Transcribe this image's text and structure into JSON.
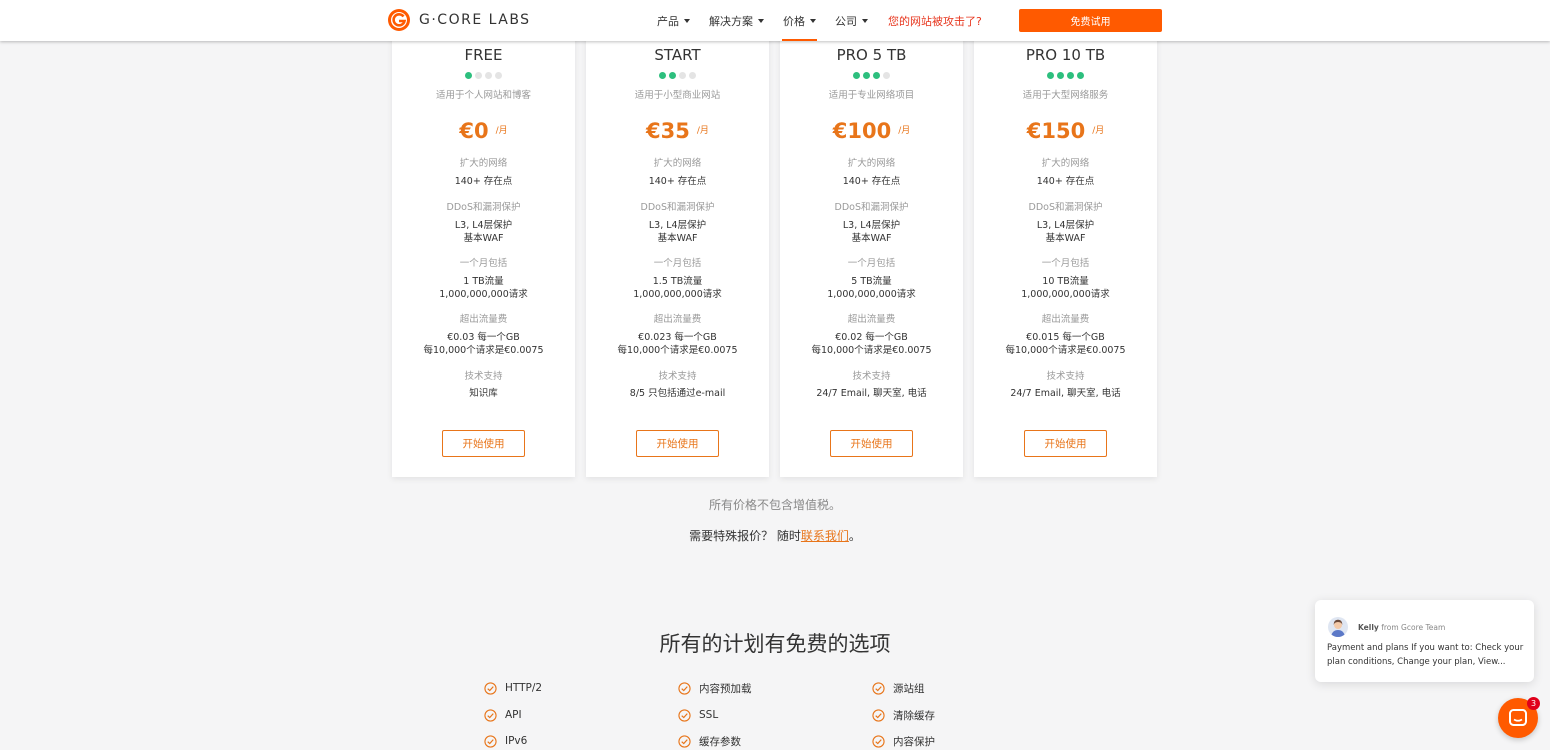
{
  "header": {
    "logo_text": "G·CORE LABS",
    "nav": [
      {
        "label": "产品",
        "dropdown": true
      },
      {
        "label": "解决方案",
        "dropdown": true
      },
      {
        "label": "价格",
        "dropdown": true,
        "active": true
      },
      {
        "label": "公司",
        "dropdown": true
      }
    ],
    "alert_link": "您的网站被攻击了?",
    "trial_button": "免费试用"
  },
  "colors": {
    "accent": "#ff5a00",
    "price": "#e8751a",
    "dot_on": "#2dbf7e",
    "alert": "#e7361e"
  },
  "plans": [
    {
      "name": "FREE",
      "level": 1,
      "desc": "适用于个人网站和博客",
      "price": "€0",
      "unit": "/月",
      "net_label": "扩大的网络",
      "net_val": "140+ 存在点",
      "ddos_label": "DDoS和漏洞保护",
      "ddos_val1": "L3, L4层保护",
      "ddos_val2": "基本WAF",
      "incl_label": "一个月包括",
      "incl_val1": "1 TB流量",
      "incl_val2": "1,000,000,000请求",
      "over_label": "超出流量费",
      "over_val1": "€0.03 每一个GB",
      "over_val2": "每10,000个请求是€0.0075",
      "sup_label": "技术支持",
      "sup_val": "知识库",
      "button": "开始使用"
    },
    {
      "name": "START",
      "level": 2,
      "desc": "适用于小型商业网站",
      "price": "€35",
      "unit": "/月",
      "net_label": "扩大的网络",
      "net_val": "140+ 存在点",
      "ddos_label": "DDoS和漏洞保护",
      "ddos_val1": "L3, L4层保护",
      "ddos_val2": "基本WAF",
      "incl_label": "一个月包括",
      "incl_val1": "1.5 TB流量",
      "incl_val2": "1,000,000,000请求",
      "over_label": "超出流量费",
      "over_val1": "€0.023 每一个GB",
      "over_val2": "每10,000个请求是€0.0075",
      "sup_label": "技术支持",
      "sup_val": "8/5 只包括通过e-mail",
      "button": "开始使用"
    },
    {
      "name": "PRO 5 TB",
      "level": 3,
      "desc": "适用于专业网络项目",
      "price": "€100",
      "unit": "/月",
      "net_label": "扩大的网络",
      "net_val": "140+ 存在点",
      "ddos_label": "DDoS和漏洞保护",
      "ddos_val1": "L3, L4层保护",
      "ddos_val2": "基本WAF",
      "incl_label": "一个月包括",
      "incl_val1": "5 TB流量",
      "incl_val2": "1,000,000,000请求",
      "over_label": "超出流量费",
      "over_val1": "€0.02 每一个GB",
      "over_val2": "每10,000个请求是€0.0075",
      "sup_label": "技术支持",
      "sup_val": "24/7 Email, 聊天室, 电话",
      "button": "开始使用"
    },
    {
      "name": "PRO 10 TB",
      "level": 4,
      "desc": "适用于大型网络服务",
      "price": "€150",
      "unit": "/月",
      "net_label": "扩大的网络",
      "net_val": "140+ 存在点",
      "ddos_label": "DDoS和漏洞保护",
      "ddos_val1": "L3, L4层保护",
      "ddos_val2": "基本WAF",
      "incl_label": "一个月包括",
      "incl_val1": "10 TB流量",
      "incl_val2": "1,000,000,000请求",
      "over_label": "超出流量费",
      "over_val1": "€0.015 每一个GB",
      "over_val2": "每10,000个请求是€0.0075",
      "sup_label": "技术支持",
      "sup_val": "24/7 Email, 聊天室, 电话",
      "button": "开始使用"
    }
  ],
  "notes": {
    "vat": "所有价格不包含增值税。",
    "contact_prefix": "需要特殊报价？ 随时",
    "contact_link": "联系我们",
    "contact_suffix": "。"
  },
  "free_options": {
    "title": "所有的计划有免费的选项",
    "items": [
      "HTTP/2",
      "内容预加载",
      "源站组",
      "API",
      "SSL",
      "清除缓存",
      "IPv6",
      "缓存参数",
      "内容保护"
    ]
  },
  "chat": {
    "sender_name": "Kelly",
    "sender_team": "from Gcore Team",
    "message": "Payment and plans If you want to: Check your plan conditions, Change your plan, View...",
    "badge": "3"
  }
}
